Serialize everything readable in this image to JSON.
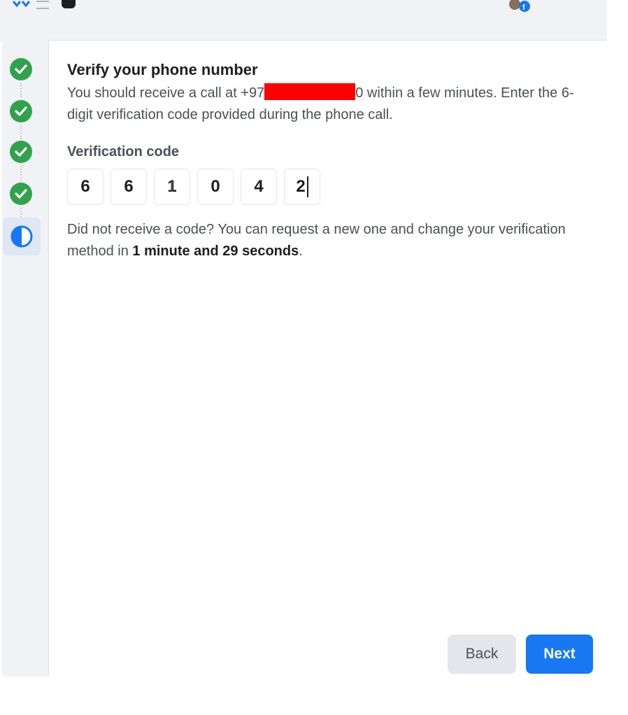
{
  "topbar": {
    "icons": [
      "chevrons-icon",
      "lines-icon",
      "dark-shape-icon",
      "avatar-icon"
    ]
  },
  "stepper": {
    "steps": [
      {
        "status": "completed",
        "icon": "check-icon"
      },
      {
        "status": "completed",
        "icon": "check-icon"
      },
      {
        "status": "completed",
        "icon": "check-icon"
      },
      {
        "status": "completed",
        "icon": "check-icon"
      },
      {
        "status": "in-progress",
        "icon": "half-circle-icon"
      }
    ]
  },
  "main": {
    "title": "Verify your phone number",
    "desc_prefix": "You should receive a call at +97",
    "desc_suffix": "0 within a few minutes. Enter the 6-digit verification code provided during the phone call.",
    "code_label": "Verification code",
    "code_digits": [
      "6",
      "6",
      "1",
      "0",
      "4",
      "2"
    ],
    "resend_prefix": "Did not receive a code? You can request a new one and change your verification method in ",
    "resend_time": "1 minute and 29 seconds",
    "resend_suffix": "."
  },
  "buttons": {
    "back": "Back",
    "next": "Next"
  },
  "colors": {
    "accent": "#1877f2",
    "success": "#31a24c",
    "redaction": "#ff0000"
  }
}
